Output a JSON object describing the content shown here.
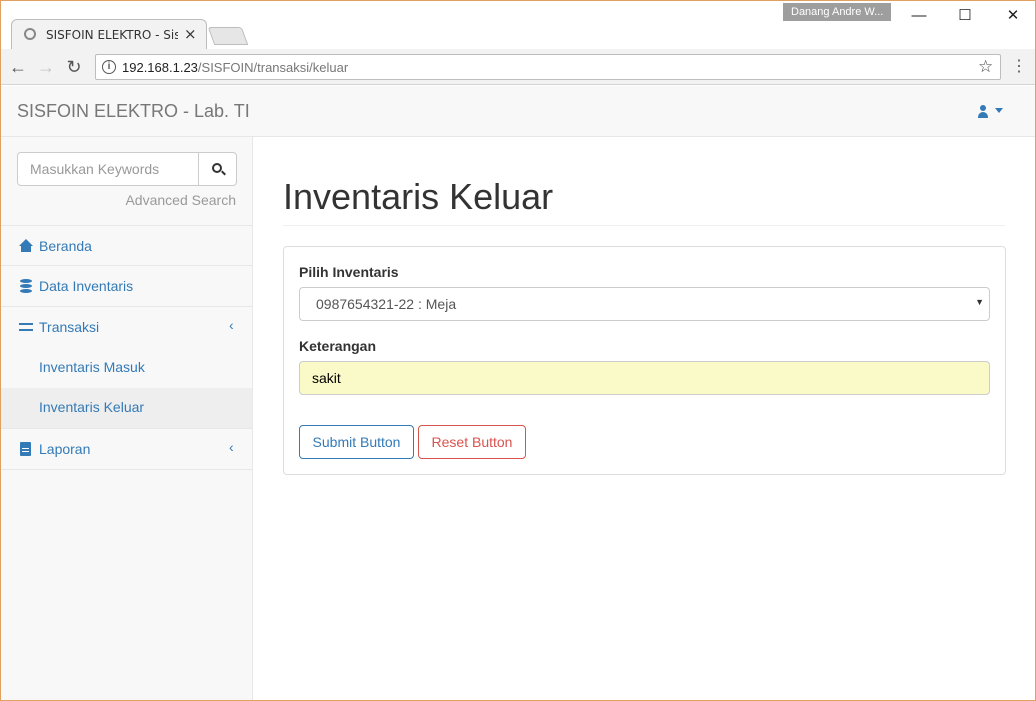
{
  "browser": {
    "tab_title": "SISFOIN ELEKTRO - Sistem",
    "user_badge": "Danang Andre W...",
    "url_host": "192.168.1.23",
    "url_path": "/SISFOIN/transaksi/keluar",
    "min_glyph": "—",
    "max_glyph": "☐",
    "close_glyph": "✕"
  },
  "navbar": {
    "brand": "SISFOIN ELEKTRO - Lab. TI"
  },
  "sidebar": {
    "search_placeholder": "Masukkan Keywords",
    "advanced_search": "Advanced Search",
    "items": [
      {
        "label": "Beranda",
        "icon": "home-icon"
      },
      {
        "label": "Data Inventaris",
        "icon": "database-icon"
      },
      {
        "label": "Transaksi",
        "icon": "exchange-icon",
        "expanded": true,
        "children": [
          {
            "label": "Inventaris Masuk",
            "active": false
          },
          {
            "label": "Inventaris Keluar",
            "active": true
          }
        ]
      },
      {
        "label": "Laporan",
        "icon": "file-icon"
      }
    ]
  },
  "main": {
    "title": "Inventaris Keluar",
    "form": {
      "inventaris_label": "Pilih Inventaris",
      "inventaris_value": "0987654321-22 : Meja",
      "keterangan_label": "Keterangan",
      "keterangan_value": "sakit",
      "submit_label": "Submit Button",
      "reset_label": "Reset Button"
    }
  },
  "colors": {
    "link": "#337ab7",
    "danger": "#d9534f",
    "autofill": "#fafac8"
  }
}
